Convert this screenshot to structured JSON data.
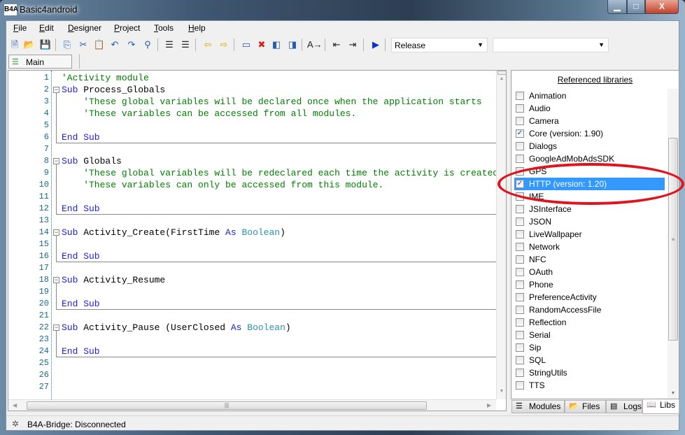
{
  "window": {
    "title": "Basic4android",
    "logo": "B4A",
    "minimize": "▁",
    "maximize": "□",
    "close": "X"
  },
  "menu": [
    {
      "label": "File",
      "u": "F",
      "rest": "ile"
    },
    {
      "label": "Edit",
      "u": "E",
      "rest": "dit"
    },
    {
      "label": "Designer",
      "u": "D",
      "rest": "esigner"
    },
    {
      "label": "Project",
      "u": "P",
      "rest": "roject"
    },
    {
      "label": "Tools",
      "u": "T",
      "rest": "ools"
    },
    {
      "label": "Help",
      "u": "H",
      "rest": "elp"
    }
  ],
  "toolbar": {
    "icons": [
      "new-file",
      "open-folder",
      "save",
      "copy",
      "cut",
      "paste",
      "undo",
      "redo",
      "find",
      "block-comment",
      "block-uncomment",
      "navigate-back",
      "navigate-forward",
      "breakpoint",
      "remove-breakpoints",
      "previous-bookmark",
      "next-bookmark",
      "autocomplete",
      "outdent",
      "indent",
      "run"
    ],
    "build_config": "Release",
    "device": ""
  },
  "tabs": {
    "main": "Main"
  },
  "code": [
    {
      "n": "1",
      "segs": [
        [
          "cm",
          "'Activity module"
        ]
      ]
    },
    {
      "n": "2",
      "segs": [
        [
          "kw",
          "Sub"
        ],
        [
          "tx",
          " Process_Globals"
        ]
      ],
      "fold": true
    },
    {
      "n": "3",
      "segs": [
        [
          "cm",
          "    'These global variables will be declared once when the application starts"
        ]
      ]
    },
    {
      "n": "4",
      "segs": [
        [
          "cm",
          "    'These variables can be accessed from all modules."
        ]
      ]
    },
    {
      "n": "5",
      "segs": []
    },
    {
      "n": "6",
      "segs": [
        [
          "kw",
          "End Sub"
        ]
      ],
      "end": true
    },
    {
      "n": "7",
      "segs": []
    },
    {
      "n": "8",
      "segs": [
        [
          "kw",
          "Sub"
        ],
        [
          "tx",
          " Globals"
        ]
      ],
      "fold": true
    },
    {
      "n": "9",
      "segs": [
        [
          "cm",
          "    'These global variables will be redeclared each time the activity is created"
        ]
      ]
    },
    {
      "n": "10",
      "segs": [
        [
          "cm",
          "    'These variables can only be accessed from this module."
        ]
      ]
    },
    {
      "n": "11",
      "segs": []
    },
    {
      "n": "12",
      "segs": [
        [
          "kw",
          "End Sub"
        ]
      ],
      "end": true
    },
    {
      "n": "13",
      "segs": []
    },
    {
      "n": "14",
      "segs": [
        [
          "kw",
          "Sub"
        ],
        [
          "tx",
          " Activity_Create(FirstTime "
        ],
        [
          "kw",
          "As"
        ],
        [
          "tx",
          " "
        ],
        [
          "ty",
          "Boolean"
        ],
        [
          "tx",
          ")"
        ]
      ],
      "fold": true
    },
    {
      "n": "15",
      "segs": []
    },
    {
      "n": "16",
      "segs": [
        [
          "kw",
          "End Sub"
        ]
      ],
      "end": true
    },
    {
      "n": "17",
      "segs": []
    },
    {
      "n": "18",
      "segs": [
        [
          "kw",
          "Sub"
        ],
        [
          "tx",
          " Activity_Resume"
        ]
      ],
      "fold": true
    },
    {
      "n": "19",
      "segs": []
    },
    {
      "n": "20",
      "segs": [
        [
          "kw",
          "End Sub"
        ]
      ],
      "end": true
    },
    {
      "n": "21",
      "segs": []
    },
    {
      "n": "22",
      "segs": [
        [
          "kw",
          "Sub"
        ],
        [
          "tx",
          " Activity_Pause (UserClosed "
        ],
        [
          "kw",
          "As"
        ],
        [
          "tx",
          " "
        ],
        [
          "ty",
          "Boolean"
        ],
        [
          "tx",
          ")"
        ]
      ],
      "fold": true
    },
    {
      "n": "23",
      "segs": []
    },
    {
      "n": "24",
      "segs": [
        [
          "kw",
          "End Sub"
        ]
      ],
      "end": true
    },
    {
      "n": "25",
      "segs": []
    },
    {
      "n": "26",
      "segs": []
    },
    {
      "n": "27",
      "segs": []
    }
  ],
  "libraries": {
    "title": "Referenced libraries",
    "items": [
      {
        "label": "Animation",
        "checked": false
      },
      {
        "label": "Audio",
        "checked": false
      },
      {
        "label": "Camera",
        "checked": false
      },
      {
        "label": "Core (version: 1.90)",
        "checked": true
      },
      {
        "label": "Dialogs",
        "checked": false
      },
      {
        "label": "GoogleAdMobAdsSDK",
        "checked": false
      },
      {
        "label": "GPS",
        "checked": false
      },
      {
        "label": "HTTP (version: 1.20)",
        "checked": true,
        "selected": true
      },
      {
        "label": "IME",
        "checked": false
      },
      {
        "label": "JSInterface",
        "checked": false
      },
      {
        "label": "JSON",
        "checked": false
      },
      {
        "label": "LiveWallpaper",
        "checked": false
      },
      {
        "label": "Network",
        "checked": false
      },
      {
        "label": "NFC",
        "checked": false
      },
      {
        "label": "OAuth",
        "checked": false
      },
      {
        "label": "Phone",
        "checked": false
      },
      {
        "label": "PreferenceActivity",
        "checked": false
      },
      {
        "label": "RandomAccessFile",
        "checked": false
      },
      {
        "label": "Reflection",
        "checked": false
      },
      {
        "label": "Serial",
        "checked": false
      },
      {
        "label": "Sip",
        "checked": false
      },
      {
        "label": "SQL",
        "checked": false
      },
      {
        "label": "StringUtils",
        "checked": false
      },
      {
        "label": "TTS",
        "checked": false
      }
    ]
  },
  "bottom_tabs": [
    {
      "label": "Modules",
      "icon": "modules-icon"
    },
    {
      "label": "Files",
      "icon": "folder-icon"
    },
    {
      "label": "Logs",
      "icon": "logs-icon"
    },
    {
      "label": "Libs",
      "icon": "book-icon",
      "active": true
    }
  ],
  "status": {
    "text": "B4A-Bridge: Disconnected"
  },
  "colors": {
    "highlight": "#3399ff",
    "annotation": "#e0141e",
    "keyword": "#2020e0",
    "comment": "#008000",
    "type": "#2b91af"
  }
}
